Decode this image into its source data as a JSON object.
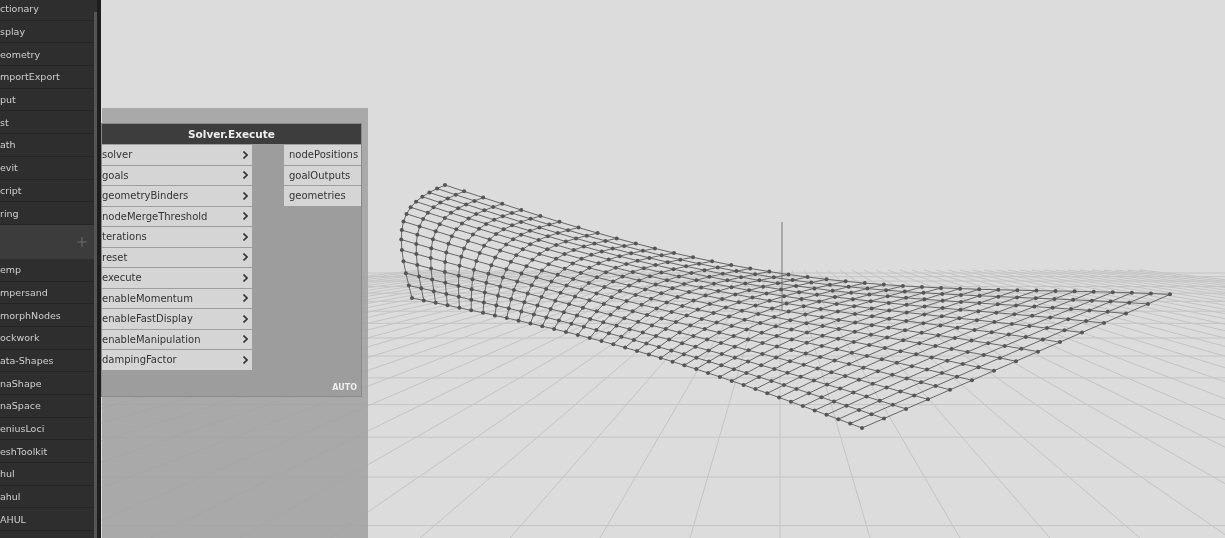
{
  "library": {
    "items": [
      {
        "label": "ctionary",
        "kind": "item"
      },
      {
        "label": "splay",
        "kind": "item"
      },
      {
        "label": "eometry",
        "kind": "item"
      },
      {
        "label": "mportExport",
        "kind": "item"
      },
      {
        "label": "put",
        "kind": "item"
      },
      {
        "label": "st",
        "kind": "item"
      },
      {
        "label": "ath",
        "kind": "item"
      },
      {
        "label": "evit",
        "kind": "item"
      },
      {
        "label": "cript",
        "kind": "item"
      },
      {
        "label": "ring",
        "kind": "item"
      },
      {
        "kind": "header"
      },
      {
        "label": "emp",
        "kind": "item"
      },
      {
        "label": "mpersand",
        "kind": "item"
      },
      {
        "label": "morphNodes",
        "kind": "item"
      },
      {
        "label": "ockwork",
        "kind": "item"
      },
      {
        "label": "ata-Shapes",
        "kind": "item"
      },
      {
        "label": "naShape",
        "kind": "item"
      },
      {
        "label": "naSpace",
        "kind": "item"
      },
      {
        "label": "eniusLoci",
        "kind": "item"
      },
      {
        "label": "eshToolkit",
        "kind": "item"
      },
      {
        "label": "hul",
        "kind": "item"
      },
      {
        "label": "ahul",
        "kind": "item"
      },
      {
        "label": "AHUL",
        "kind": "item"
      }
    ]
  },
  "node": {
    "title": "Solver.Execute",
    "inputs": [
      "solver",
      "goals",
      "geometryBinders",
      "nodeMergeThreshold",
      "terations",
      "reset",
      "execute",
      "enableMomentum",
      "enableFastDisplay",
      "enableManipulation",
      "dampingFactor"
    ],
    "outputs": [
      "nodePositions",
      "goalOutputs",
      "geometries"
    ],
    "lacing": "AUTO"
  }
}
